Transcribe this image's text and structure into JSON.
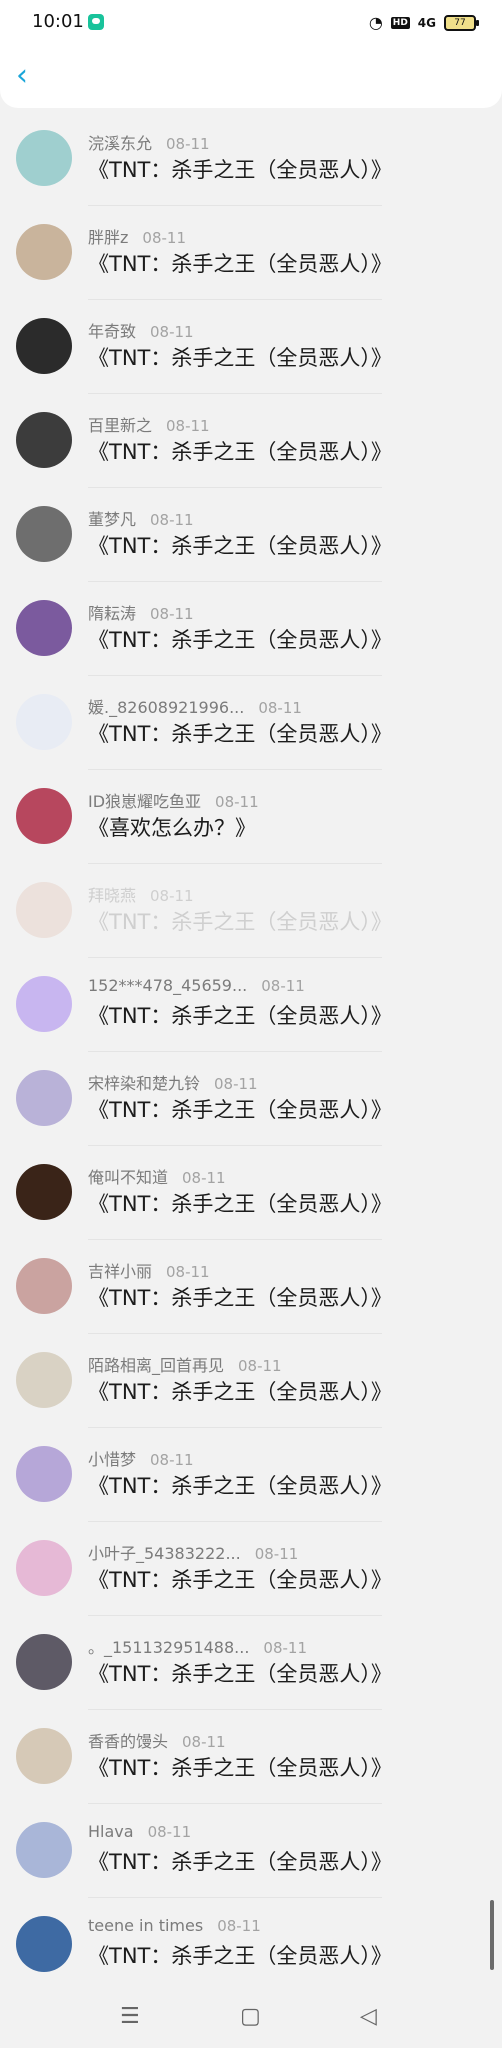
{
  "status": {
    "time": "10:01",
    "hd": "HD",
    "signal": "4G",
    "battery": "77"
  },
  "header": {
    "back_icon": "chevron-left-icon"
  },
  "items": [
    {
      "name": "浣溪东允",
      "date": "08-11",
      "title": "《TNT：杀手之王（全员恶人）》",
      "avatar_color": "#9fcfcf"
    },
    {
      "name": "胖胖z",
      "date": "08-11",
      "title": "《TNT：杀手之王（全员恶人）》",
      "avatar_color": "#c9b49c"
    },
    {
      "name": "年奇致",
      "date": "08-11",
      "title": "《TNT：杀手之王（全员恶人）》",
      "avatar_color": "#2b2b2b"
    },
    {
      "name": "百里新之",
      "date": "08-11",
      "title": "《TNT：杀手之王（全员恶人）》",
      "avatar_color": "#3c3c3c"
    },
    {
      "name": "董梦凡",
      "date": "08-11",
      "title": "《TNT：杀手之王（全员恶人）》",
      "avatar_color": "#6e6e6e"
    },
    {
      "name": "隋耘涛",
      "date": "08-11",
      "title": "《TNT：杀手之王（全员恶人）》",
      "avatar_color": "#7b5a9e"
    },
    {
      "name": "媛._82608921996...",
      "date": "08-11",
      "title": "《TNT：杀手之王（全员恶人）》",
      "avatar_color": "#e8ecf4"
    },
    {
      "name": "ID狼崽耀吃鱼亚",
      "date": "08-11",
      "title": "《喜欢怎么办？》",
      "avatar_color": "#b7475e"
    },
    {
      "name": "拜晓燕",
      "date": "08-11",
      "title": "《TNT：杀手之王（全员恶人）》",
      "avatar_color": "#e5cfc6",
      "faded": true
    },
    {
      "name": "152***478_45659...",
      "date": "08-11",
      "title": "《TNT：杀手之王（全员恶人）》",
      "avatar_color": "#c8b6f0"
    },
    {
      "name": "宋梓染和楚九铃",
      "date": "08-11",
      "title": "《TNT：杀手之王（全员恶人）》",
      "avatar_color": "#b9b2d8"
    },
    {
      "name": "俺叫不知道",
      "date": "08-11",
      "title": "《TNT：杀手之王（全员恶人）》",
      "avatar_color": "#3a2418"
    },
    {
      "name": "吉祥小丽",
      "date": "08-11",
      "title": "《TNT：杀手之王（全员恶人）》",
      "avatar_color": "#caa3a0"
    },
    {
      "name": "陌路相离_回首再见",
      "date": "08-11",
      "title": "《TNT：杀手之王（全员恶人）》",
      "avatar_color": "#d9d2c4"
    },
    {
      "name": "小惜梦",
      "date": "08-11",
      "title": "《TNT：杀手之王（全员恶人）》",
      "avatar_color": "#b6a7d8"
    },
    {
      "name": "小叶子_54383222...",
      "date": "08-11",
      "title": "《TNT：杀手之王（全员恶人）》",
      "avatar_color": "#e6b9d6"
    },
    {
      "name": "。_151132951488...",
      "date": "08-11",
      "title": "《TNT：杀手之王（全员恶人）》",
      "avatar_color": "#5e5a66"
    },
    {
      "name": "香香的馒头",
      "date": "08-11",
      "title": "《TNT：杀手之王（全员恶人）》",
      "avatar_color": "#d6c9b7"
    },
    {
      "name": "Hlava",
      "date": "08-11",
      "title": "《TNT：杀手之王（全员恶人）》",
      "avatar_color": "#a9b6d8"
    },
    {
      "name": "teene in times",
      "date": "08-11",
      "title": "《TNT：杀手之王（全员恶人）》",
      "avatar_color": "#3e6aa3"
    }
  ],
  "navbar": {
    "menu_icon": "menu-icon",
    "home_icon": "square-home-icon",
    "back_icon": "triangle-back-icon"
  }
}
